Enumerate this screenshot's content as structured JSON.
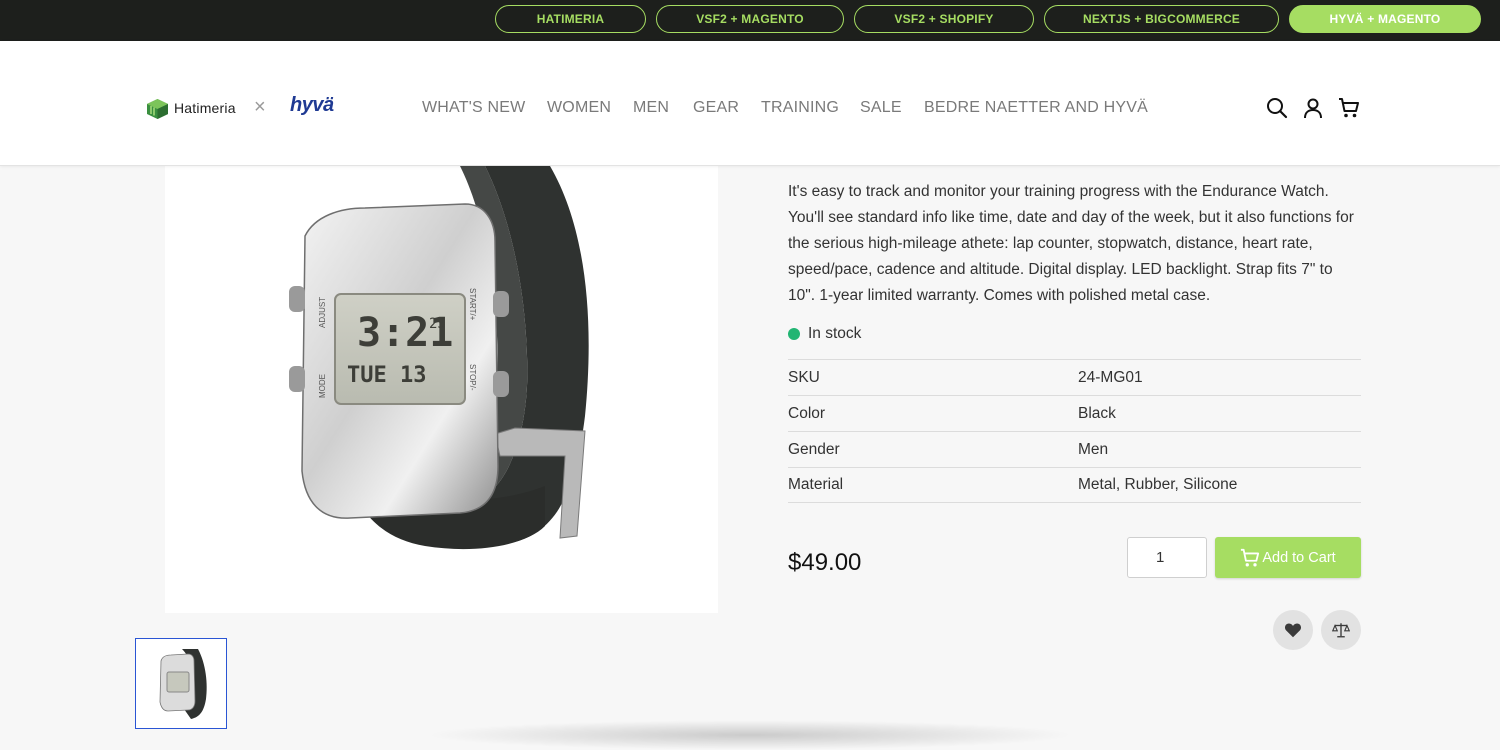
{
  "switcher": {
    "items": [
      {
        "label": "HATIMERIA",
        "active": false
      },
      {
        "label": "VSF2 + MAGENTO",
        "active": false
      },
      {
        "label": "VSF2 + SHOPIFY",
        "active": false
      },
      {
        "label": "NEXTJS + BIGCOMMERCE",
        "active": false
      },
      {
        "label": "HYVÄ + MAGENTO",
        "active": true
      }
    ]
  },
  "header": {
    "brand": "Hatimeria",
    "separator": "×",
    "partner": "hyvä",
    "nav": [
      "WHAT'S NEW",
      "WOMEN",
      "MEN",
      "GEAR",
      "TRAINING",
      "SALE",
      "BEDRE NAETTER AND HYVÄ"
    ],
    "icons": [
      "search-icon",
      "account-icon",
      "cart-icon"
    ]
  },
  "product": {
    "description": "It's easy to track and monitor your training progress with the Endurance Watch. You'll see standard info like time, date and day of the week, but it also functions for the serious high-mileage athete: lap counter, stopwatch, distance, heart rate, speed/pace, cadence and altitude. Digital display. LED backlight. Strap fits 7\" to 10\". 1-year limited warranty. Comes with polished metal case.",
    "stock": "In stock",
    "attributes": [
      {
        "label": "SKU",
        "value": "24-MG01"
      },
      {
        "label": "Color",
        "value": "Black"
      },
      {
        "label": "Gender",
        "value": "Men"
      },
      {
        "label": "Material",
        "value": "Metal, Rubber, Silicone"
      }
    ],
    "price": "$49.00",
    "quantity": "1",
    "add_to_cart": "Add to Cart",
    "watch_display": {
      "time": "3:21",
      "seconds": "25",
      "day": "TUE 13",
      "left_top": "ADJUST",
      "left_bottom": "MODE",
      "right_top": "START/+",
      "right_bottom": "STOP/-"
    }
  },
  "colors": {
    "accent": "#a6dd62",
    "topbar": "#1d1f1c",
    "stock": "#22b573",
    "hyva": "#1f3a93"
  }
}
